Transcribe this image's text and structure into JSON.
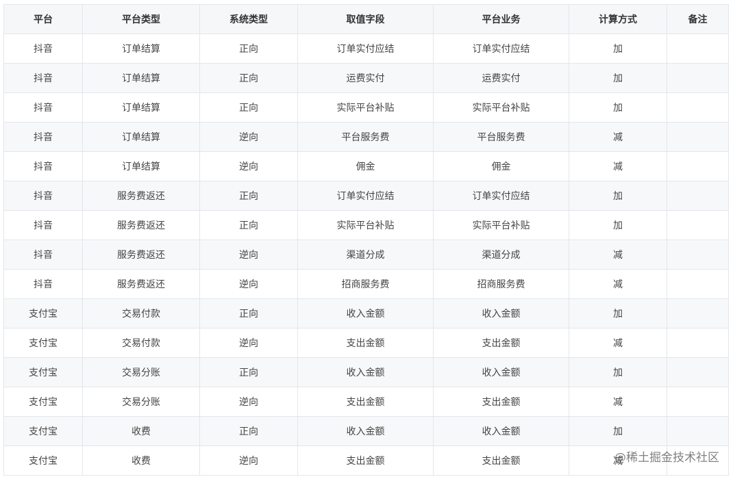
{
  "table": {
    "headers": [
      "平台",
      "平台类型",
      "系统类型",
      "取值字段",
      "平台业务",
      "计算方式",
      "备注"
    ],
    "rows": [
      [
        "抖音",
        "订单结算",
        "正向",
        "订单实付应结",
        "订单实付应结",
        "加",
        ""
      ],
      [
        "抖音",
        "订单结算",
        "正向",
        "运费实付",
        "运费实付",
        "加",
        ""
      ],
      [
        "抖音",
        "订单结算",
        "正向",
        "实际平台补贴",
        "实际平台补贴",
        "加",
        ""
      ],
      [
        "抖音",
        "订单结算",
        "逆向",
        "平台服务费",
        "平台服务费",
        "减",
        ""
      ],
      [
        "抖音",
        "订单结算",
        "逆向",
        "佣金",
        "佣金",
        "减",
        ""
      ],
      [
        "抖音",
        "服务费返还",
        "正向",
        "订单实付应结",
        "订单实付应结",
        "加",
        ""
      ],
      [
        "抖音",
        "服务费返还",
        "正向",
        "实际平台补贴",
        "实际平台补贴",
        "加",
        ""
      ],
      [
        "抖音",
        "服务费返还",
        "逆向",
        "渠道分成",
        "渠道分成",
        "减",
        ""
      ],
      [
        "抖音",
        "服务费返还",
        "逆向",
        "招商服务费",
        "招商服务费",
        "减",
        ""
      ],
      [
        "支付宝",
        "交易付款",
        "正向",
        "收入金额",
        "收入金额",
        "加",
        ""
      ],
      [
        "支付宝",
        "交易付款",
        "逆向",
        "支出金额",
        "支出金额",
        "减",
        ""
      ],
      [
        "支付宝",
        "交易分账",
        "正向",
        "收入金额",
        "收入金额",
        "加",
        ""
      ],
      [
        "支付宝",
        "交易分账",
        "逆向",
        "支出金额",
        "支出金额",
        "减",
        ""
      ],
      [
        "支付宝",
        "收费",
        "正向",
        "收入金额",
        "收入金额",
        "加",
        ""
      ],
      [
        "支付宝",
        "收费",
        "逆向",
        "支出金额",
        "支出金额",
        "减",
        ""
      ]
    ]
  },
  "watermark": {
    "text": "@稀土掘金技术社区"
  }
}
